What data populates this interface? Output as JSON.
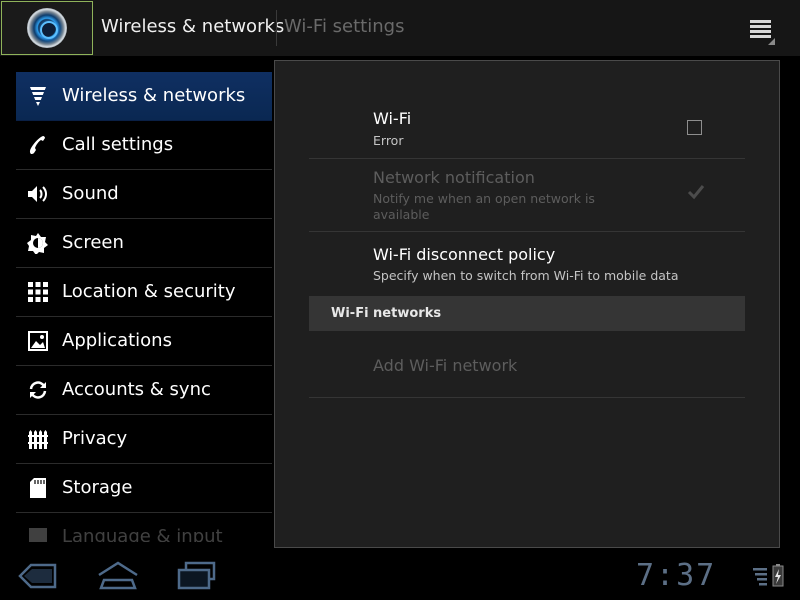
{
  "action_bar": {
    "app_icon": "settings-orb-icon",
    "title": "Wireless & networks",
    "subtitle": "Wi-Fi settings",
    "overflow_icon": "overflow-menu-icon"
  },
  "nav": {
    "items": [
      {
        "label": "Wireless & networks",
        "icon": "wireless-icon",
        "selected": true
      },
      {
        "label": "Call settings",
        "icon": "phone-handset-icon",
        "selected": false
      },
      {
        "label": "Sound",
        "icon": "speaker-icon",
        "selected": false
      },
      {
        "label": "Screen",
        "icon": "brightness-icon",
        "selected": false
      },
      {
        "label": "Location & security",
        "icon": "location-grid-icon",
        "selected": false
      },
      {
        "label": "Applications",
        "icon": "applications-icon",
        "selected": false
      },
      {
        "label": "Accounts & sync",
        "icon": "sync-icon",
        "selected": false
      },
      {
        "label": "Privacy",
        "icon": "fence-icon",
        "selected": false
      },
      {
        "label": "Storage",
        "icon": "sd-card-icon",
        "selected": false
      },
      {
        "label": "Language & input",
        "icon": "language-icon",
        "selected": false
      }
    ]
  },
  "wifi_settings": {
    "wifi": {
      "title": "Wi-Fi",
      "summary": "Error",
      "checked": false,
      "enabled": true
    },
    "network_notification": {
      "title": "Network notification",
      "summary": "Notify me when an open network is available",
      "checked": true,
      "enabled": false
    },
    "disconnect_policy": {
      "title": "Wi-Fi disconnect policy",
      "summary": "Specify when to switch from Wi-Fi to mobile data"
    },
    "networks_header": "Wi-Fi networks",
    "add_network": {
      "title": "Add Wi-Fi network",
      "enabled": false
    }
  },
  "system_bar": {
    "back_icon": "back-icon",
    "home_icon": "home-icon",
    "recents_icon": "recent-apps-icon",
    "time": "7:37",
    "status_icons": [
      "signal-icon",
      "battery-charging-icon"
    ]
  },
  "colors": {
    "selected_bg": "#0f2f62",
    "panel_bg": "#1f1f1f",
    "header_bg": "#353535",
    "clock": "#5c6f86",
    "icon_box_border": "#8fb35a"
  }
}
